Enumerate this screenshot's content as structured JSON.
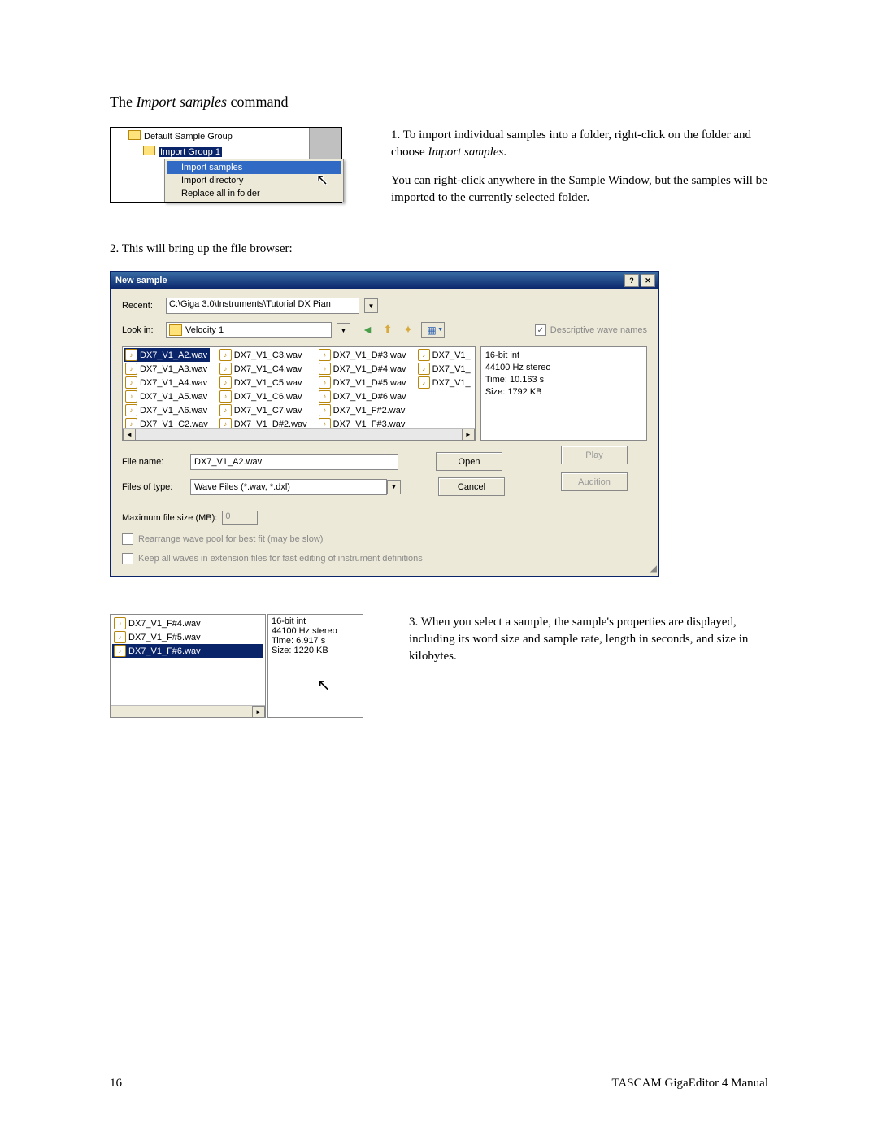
{
  "heading": {
    "prefix": "The ",
    "italic": "Import samples",
    "suffix": " command"
  },
  "tree": {
    "root": "Default Sample Group",
    "child": "Import Group 1",
    "menu": {
      "item1": "Import samples",
      "item2": "Import directory",
      "item3": "Replace all in folder"
    }
  },
  "step1": {
    "line1a": "1. To import individual samples into a folder, right-click on the folder and choose ",
    "line1b": "Import samples",
    "line1c": ".",
    "para2": "You can right-click anywhere in the Sample Window, but the samples will be imported to the currently selected folder."
  },
  "step2": "2. This will bring up the file browser:",
  "dialog": {
    "title": "New sample",
    "recent_label": "Recent:",
    "recent_value": "C:\\Giga 3.0\\Instruments\\Tutorial DX Pian",
    "lookin_label": "Look in:",
    "lookin_value": "Velocity 1",
    "desc_chk": "Descriptive wave names",
    "files": {
      "col1": [
        "DX7_V1_A2.wav",
        "DX7_V1_A3.wav",
        "DX7_V1_A4.wav",
        "DX7_V1_A5.wav",
        "DX7_V1_A6.wav",
        "DX7_V1_C2.wav"
      ],
      "col2": [
        "DX7_V1_C3.wav",
        "DX7_V1_C4.wav",
        "DX7_V1_C5.wav",
        "DX7_V1_C6.wav",
        "DX7_V1_C7.wav",
        "DX7_V1_D#2.wav"
      ],
      "col3": [
        "DX7_V1_D#3.wav",
        "DX7_V1_D#4.wav",
        "DX7_V1_D#5.wav",
        "DX7_V1_D#6.wav",
        "DX7_V1_F#2.wav",
        "DX7_V1_F#3.wav"
      ],
      "col4": [
        "DX7_V1_",
        "DX7_V1_",
        "DX7_V1_"
      ]
    },
    "props": {
      "l1": "16-bit int",
      "l2": "44100 Hz stereo",
      "l3": "Time: 10.163 s",
      "l4": "Size: 1792 KB"
    },
    "filename_label": "File name:",
    "filename_value": "DX7_V1_A2.wav",
    "filetype_label": "Files of type:",
    "filetype_value": "Wave Files (*.wav, *.dxl)",
    "open_btn": "Open",
    "cancel_btn": "Cancel",
    "play_btn": "Play",
    "audition_btn": "Audition",
    "max_label": "Maximum file size (MB):",
    "max_value": "0",
    "opt1": "Rearrange wave pool for best fit (may be slow)",
    "opt2": "Keep all waves in extension files for fast editing of instrument definitions"
  },
  "panel3": {
    "files": [
      "DX7_V1_F#4.wav",
      "DX7_V1_F#5.wav",
      "DX7_V1_F#6.wav"
    ],
    "props": {
      "l1": "16-bit int",
      "l2": "44100 Hz stereo",
      "l3": "Time: 6.917 s",
      "l4": "Size: 1220 KB"
    }
  },
  "step3": "3. When you select a sample, the sample's properties are displayed, including its word size and sample rate, length in seconds, and size in kilobytes.",
  "footer": {
    "page": "16",
    "manual": "TASCAM GigaEditor 4 Manual"
  }
}
